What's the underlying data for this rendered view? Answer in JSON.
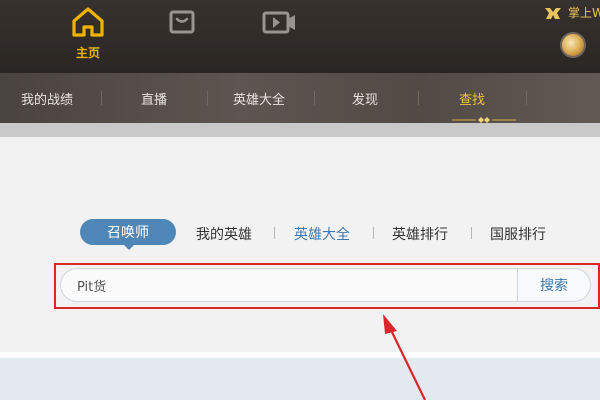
{
  "topbar": {
    "home_label": "主页",
    "brand_label": "掌上W",
    "colors": {
      "accent": "#f0b400",
      "bg": "#2f2a27"
    }
  },
  "subnav": {
    "items": [
      "我的战绩",
      "直播",
      "英雄大全",
      "发现",
      "查找"
    ],
    "active": "查找"
  },
  "tabs": {
    "items": [
      "召唤师",
      "我的英雄",
      "英雄大全",
      "英雄排行",
      "国服排行"
    ],
    "selected": "召唤师"
  },
  "search": {
    "value": "Pit货",
    "button_label": "搜索"
  },
  "icons": [
    "home-icon",
    "shop-bag-icon",
    "video-icon",
    "brand-emblem-icon",
    "avatar"
  ],
  "annotation": {
    "color": "#d9262b"
  }
}
